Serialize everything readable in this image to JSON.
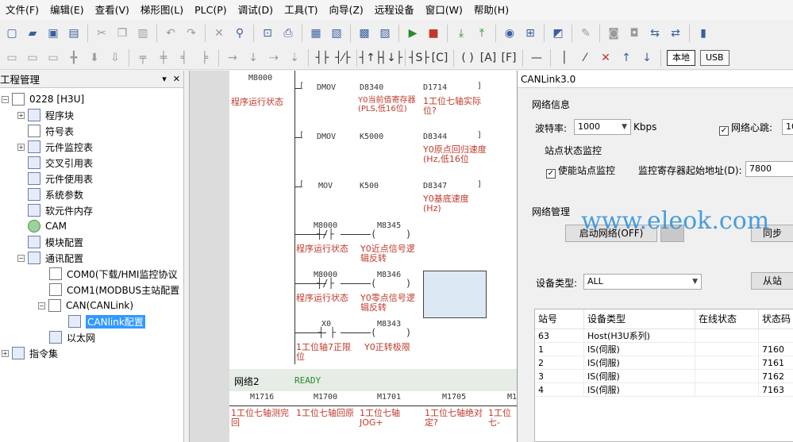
{
  "menu": [
    "文件(F)",
    "编辑(E)",
    "查看(V)",
    "梯形图(L)",
    "PLC(P)",
    "调试(D)",
    "工具(T)",
    "向导(Z)",
    "远程设备",
    "窗口(W)",
    "帮助(H)"
  ],
  "toolbar2": {
    "local_label": "本地",
    "usb_label": "USB"
  },
  "project": {
    "title": "工程管理",
    "pin": "▾",
    "close": "✕",
    "root": "0228 [H3U]",
    "items": [
      {
        "label": "程序块"
      },
      {
        "label": "符号表"
      },
      {
        "label": "元件监控表"
      },
      {
        "label": "交叉引用表"
      },
      {
        "label": "元件使用表"
      },
      {
        "label": "系统参数"
      },
      {
        "label": "软元件内存"
      },
      {
        "label": "CAM"
      },
      {
        "label": "模块配置"
      },
      {
        "label": "通讯配置"
      },
      {
        "label": "COM0(下载/HMI监控协议"
      },
      {
        "label": "COM1(MODBUS主站配置"
      },
      {
        "label": "CAN(CANLink)"
      },
      {
        "label": "CANlink配置"
      },
      {
        "label": "以太网"
      },
      {
        "label": "指令集"
      }
    ]
  },
  "ladder": {
    "contacts": {
      "m8000_top": "M8000",
      "dmov1": "DMOV",
      "d8340": "D8340",
      "d1714": "D1714",
      "dmov2": "DMOV",
      "k5000": "K5000",
      "d8344": "D8344",
      "mov": "MOV",
      "k500": "K500",
      "d8347": "D8347",
      "m8000_a": "M8000",
      "m8345": "M8345",
      "m8000_b": "M8000",
      "m8346": "M8346",
      "x0": "X0",
      "m8343": "M8343",
      "m1716": "M1716",
      "m1700": "M1700",
      "m1701": "M1701",
      "m1705": "M1705",
      "m1_cut": "M1"
    },
    "comments": {
      "run_status_1": "程序运行状态",
      "y0_current_reg": "Y0当前值寄存器(PLS,低16位)",
      "axis7_actual": "1工位七轴实际位?",
      "y0_home_speed": "Y0原点回归速度(Hz,低16位",
      "y0_base_speed": "Y0基底速度(Hz)",
      "run_status_2": "程序运行状态",
      "y0_near_logic": "Y0近点信号逻辑反转",
      "run_status_3": "程序运行状态",
      "y0_zero_logic": "Y0零点信号逻辑反转",
      "axis7_pos_limit": "1工位轴7正限位",
      "y0_forward_limit": "Y0正转极限",
      "axis7_probe": "1工位七轴测完回",
      "axis7_home": "1工位七轴回原",
      "axis7_jog": "1工位七轴JOG+",
      "axis7_abs": "1工位七轴绝对定?",
      "axis7_cut": "1工位七-"
    },
    "network2": {
      "label": "网络2",
      "status": "READY"
    }
  },
  "dialog": {
    "title": "CANLink3.0",
    "network_info": "网络信息",
    "baud_label": "波特率:",
    "baud_value": "1000",
    "baud_unit": "Kbps",
    "heartbeat_label": "网络心跳:",
    "heartbeat_checked": true,
    "heartbeat_value": "10",
    "station_monitor": "站点状态监控",
    "enable_monitor_label": "使能站点监控",
    "enable_monitor_checked": true,
    "monitor_addr_label": "监控寄存器起始地址(D):",
    "monitor_addr_value": "7800",
    "network_mgmt": "网络管理",
    "start_network": "启动网络(OFF)",
    "sync_btn": "同步",
    "watermark": "www.eleok.com",
    "device_type_label": "设备类型:",
    "device_type_value": "ALL",
    "slave_btn": "从站",
    "table": {
      "headers": [
        "站号",
        "设备类型",
        "在线状态",
        "状态码"
      ],
      "rows": [
        {
          "station": "63",
          "type": "Host(H3U系列)",
          "online": "",
          "code": ""
        },
        {
          "station": "1",
          "type": "IS(伺服)",
          "online": "",
          "code": "7160"
        },
        {
          "station": "2",
          "type": "IS(伺服)",
          "online": "",
          "code": "7161"
        },
        {
          "station": "3",
          "type": "IS(伺服)",
          "online": "",
          "code": "7162"
        },
        {
          "station": "4",
          "type": "IS(伺服)",
          "online": "",
          "code": "7163"
        }
      ]
    }
  },
  "colors": {
    "selection": "#3399ff",
    "comment_red": "#c0392b",
    "watermark_blue": "#2b8fd9"
  }
}
